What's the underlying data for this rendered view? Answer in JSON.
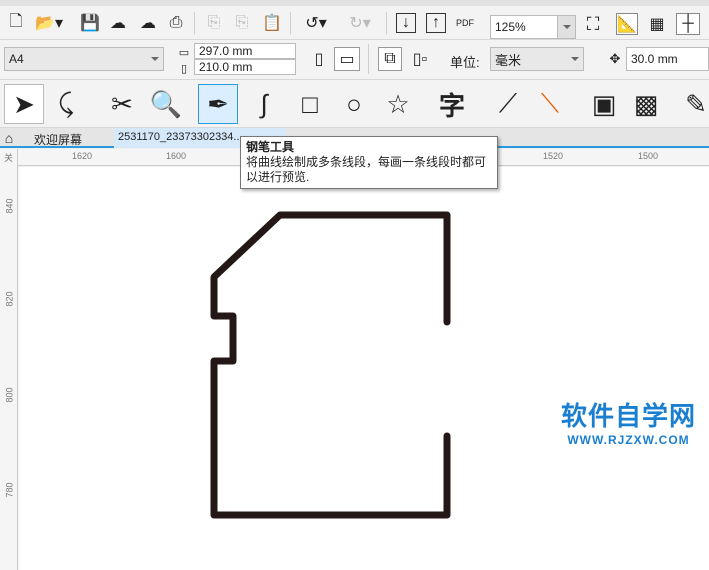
{
  "toolbar": {
    "zoom": "125%",
    "icons": [
      "new-document",
      "open",
      "save",
      "cloud-import",
      "cloud-export",
      "print",
      "cut",
      "copy",
      "paste",
      "undo",
      "redo",
      "import",
      "export",
      "publish-pdf",
      "full-screen",
      "rulers",
      "grid",
      "guidelines"
    ],
    "pdf_label": "PDF"
  },
  "property_bar": {
    "page_size": "A4",
    "width": "297.0 mm",
    "height": "210.0 mm",
    "unit_label": "单位:",
    "unit": "毫米",
    "nudge": "30.0 mm"
  },
  "toolbox": {
    "active": "pen-tool",
    "text_tool_glyph": "字"
  },
  "tabs": [
    {
      "label": "欢迎屏幕"
    },
    {
      "label": "2531170_23373302334..."
    }
  ],
  "tooltip": {
    "title": "钢笔工具",
    "body": "将曲线绘制成多条线段，每画一条线段时都可以进行预览."
  },
  "rulers": {
    "unit_glyph": "关",
    "horizontal": [
      "1620",
      "1600",
      "1520",
      "1500"
    ],
    "vertical": [
      "840",
      "820",
      "800",
      "780"
    ]
  },
  "shape": {
    "stroke": "#231815"
  },
  "watermark": {
    "title": "软件自学网",
    "url": "WWW.RJZXW.COM",
    "color": "#1a7fd0"
  }
}
